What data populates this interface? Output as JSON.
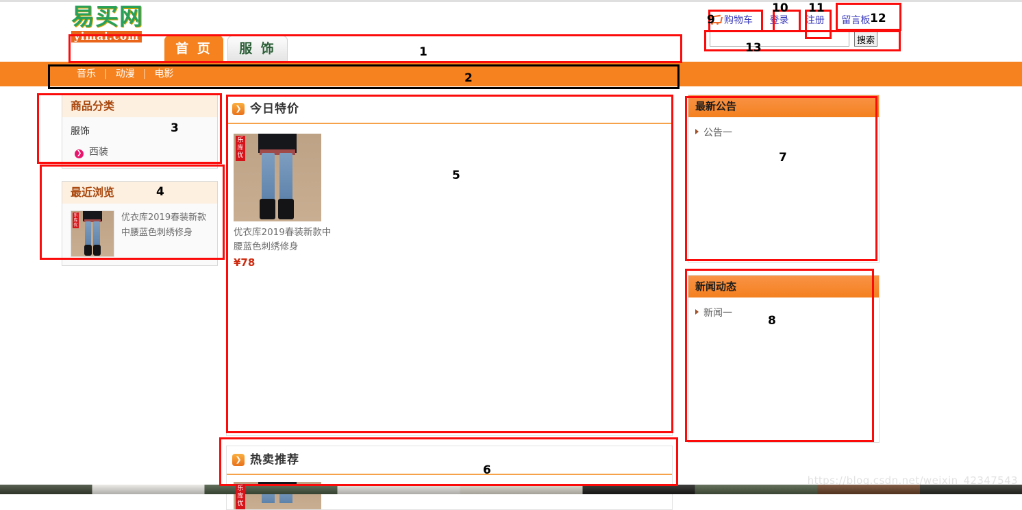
{
  "site": {
    "logo_main": "易买网",
    "logo_sub": "yimai.com"
  },
  "header": {
    "tabs": [
      {
        "label": "首 页",
        "state": "active"
      },
      {
        "label": "服 饰",
        "state": "idle"
      }
    ],
    "subnav": [
      {
        "label": "音乐"
      },
      {
        "label": "动漫"
      },
      {
        "label": "电影"
      }
    ],
    "links": [
      {
        "label": "购物车",
        "icon": "shopping-cart-icon"
      },
      {
        "label": "登录",
        "icon": ""
      },
      {
        "label": "注册",
        "icon": ""
      },
      {
        "label": "留言板",
        "icon": ""
      }
    ],
    "search": {
      "value": "",
      "placeholder": "",
      "button_label": "搜索"
    }
  },
  "sidebar_left": {
    "category_panel": {
      "title": "商品分类",
      "top_item": "服饰",
      "sub_items": [
        {
          "label": "西装",
          "icon": "chevron-circle-icon"
        }
      ]
    },
    "recent_panel": {
      "title": "最近浏览",
      "items": [
        {
          "name": "优衣库2019春装新款中腰蓝色刺绣修身",
          "badge": "乐库优",
          "image": "jeans-thumbnail"
        }
      ]
    }
  },
  "main": {
    "today_deal": {
      "title": "今日特价",
      "icon": "chevron-square-icon",
      "products": [
        {
          "name": "优衣库2019春装新款中腰蓝色刺绣修身",
          "price": "¥78",
          "badge": "乐库优",
          "image": "jeans-product"
        }
      ]
    },
    "hot_recommend": {
      "title": "热卖推荐",
      "icon": "chevron-square-icon",
      "products": [
        {
          "badge": "乐库优",
          "image": "jeans-product"
        }
      ]
    }
  },
  "sidebar_right": {
    "announcement_panel": {
      "title": "最新公告",
      "items": [
        {
          "label": "公告一",
          "icon": "triangle-bullet-icon"
        }
      ]
    },
    "news_panel": {
      "title": "新闻动态",
      "items": [
        {
          "label": "新闻一",
          "icon": "triangle-bullet-icon"
        }
      ]
    }
  },
  "annotations": {
    "color": "#fc0b0b",
    "numbers": [
      {
        "n": "1",
        "target": "header-tabs-region"
      },
      {
        "n": "2",
        "target": "subnav-bar"
      },
      {
        "n": "3",
        "target": "category-panel"
      },
      {
        "n": "4",
        "target": "recent-panel"
      },
      {
        "n": "5",
        "target": "today-deal-section"
      },
      {
        "n": "6",
        "target": "hot-recommend-section"
      },
      {
        "n": "7",
        "target": "announcement-panel"
      },
      {
        "n": "8",
        "target": "news-panel"
      },
      {
        "n": "9",
        "target": "cart-link"
      },
      {
        "n": "10",
        "target": "login-link"
      },
      {
        "n": "11",
        "target": "register-link"
      },
      {
        "n": "12",
        "target": "message-board-link"
      },
      {
        "n": "13",
        "target": "search-bar"
      }
    ]
  },
  "watermark": "https://blog.csdn.net/weixin_42347543"
}
